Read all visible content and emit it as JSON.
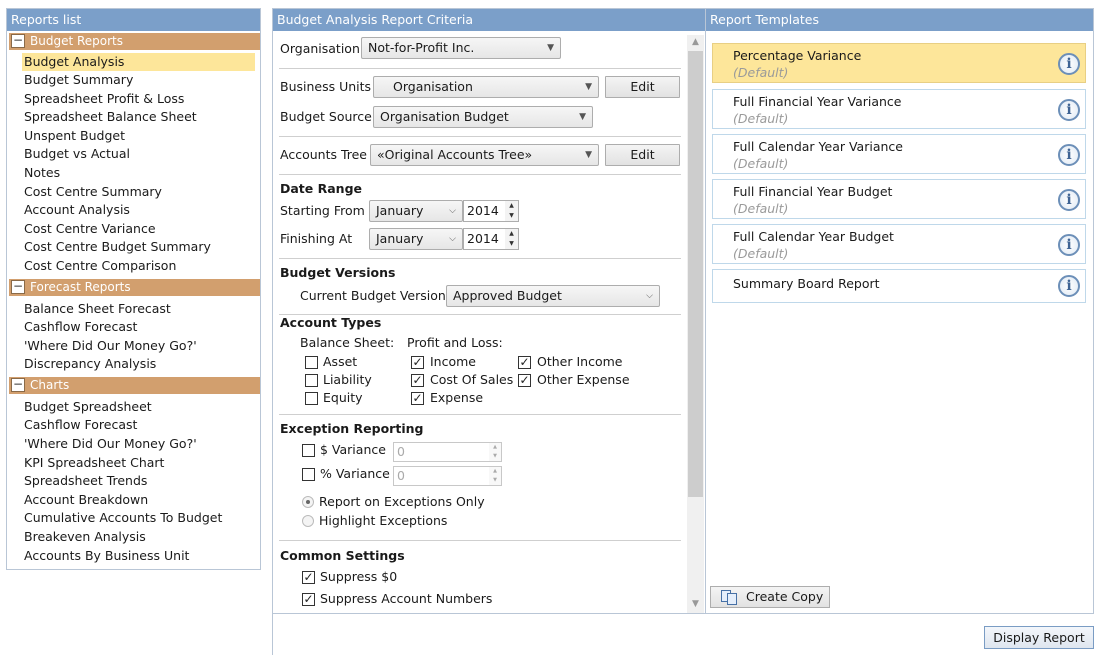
{
  "reports_list": {
    "title": "Reports list",
    "groups": [
      {
        "toggle": "−",
        "title": "Budget Reports",
        "items": [
          "Budget Analysis",
          "Budget Summary",
          "Spreadsheet Profit & Loss",
          "Spreadsheet Balance Sheet",
          "Unspent Budget",
          "Budget vs Actual",
          "Notes",
          "Cost Centre Summary",
          "Account Analysis",
          "Cost Centre Variance",
          "Cost Centre Budget Summary",
          "Cost Centre Comparison"
        ]
      },
      {
        "toggle": "−",
        "title": "Forecast Reports",
        "items": [
          "Balance Sheet Forecast",
          "Cashflow Forecast",
          "'Where Did Our Money Go?'",
          "Discrepancy Analysis"
        ]
      },
      {
        "toggle": "−",
        "title": "Charts",
        "items": [
          "Budget Spreadsheet",
          "Cashflow Forecast",
          "'Where Did Our Money Go?'",
          "KPI Spreadsheet Chart",
          "Spreadsheet Trends",
          "Account Breakdown",
          "Cumulative Accounts To Budget",
          "Breakeven Analysis",
          "Accounts By Business Unit"
        ]
      }
    ],
    "selected": "Budget Analysis"
  },
  "criteria": {
    "title": "Budget Analysis  Report Criteria",
    "organisation_label": "Organisation",
    "organisation_value": "Not-for-Profit Inc.",
    "business_units_label": "Business Units",
    "business_units_value": "Organisation",
    "edit_label": "Edit",
    "budget_source_label": "Budget Source",
    "budget_source_value": "Organisation Budget",
    "accounts_tree_label": "Accounts Tree",
    "accounts_tree_value": "«Original Accounts Tree»",
    "date_range_heading": "Date Range",
    "starting_from_label": "Starting From",
    "starting_month": "January",
    "starting_year": "2014",
    "finishing_at_label": "Finishing At",
    "finishing_month": "January",
    "finishing_year": "2014",
    "budget_versions_heading": "Budget Versions",
    "current_version_label": "Current Budget Version",
    "current_version_value": "Approved Budget",
    "account_types_heading": "Account Types",
    "balance_sheet_label": "Balance Sheet:",
    "profit_loss_label": "Profit and Loss:",
    "balance_sheet_items": [
      {
        "label": "Asset",
        "checked": false
      },
      {
        "label": "Liability",
        "checked": false
      },
      {
        "label": "Equity",
        "checked": false
      }
    ],
    "profit_loss_items": [
      {
        "label": "Income",
        "checked": true
      },
      {
        "label": "Cost Of Sales",
        "checked": true
      },
      {
        "label": "Expense",
        "checked": true
      }
    ],
    "other_items": [
      {
        "label": "Other Income",
        "checked": true
      },
      {
        "label": "Other Expense",
        "checked": true
      }
    ],
    "exception_heading": "Exception Reporting",
    "dollar_variance_label": "$ Variance",
    "dollar_variance_value": "0",
    "percent_variance_label": "% Variance",
    "percent_variance_value": "0",
    "report_exceptions_label": "Report on Exceptions Only",
    "highlight_exceptions_label": "Highlight Exceptions",
    "common_heading": "Common Settings",
    "suppress_zero_label": "Suppress $0",
    "suppress_account_numbers_label": "Suppress Account Numbers",
    "check_mark": "✓"
  },
  "templates": {
    "title": "Report Templates",
    "items": [
      {
        "name": "Percentage Variance",
        "sub": "(Default)"
      },
      {
        "name": "Full Financial Year Variance",
        "sub": "(Default)"
      },
      {
        "name": "Full Calendar Year Variance",
        "sub": "(Default)"
      },
      {
        "name": "Full Financial Year Budget",
        "sub": "(Default)"
      },
      {
        "name": "Full Calendar Year Budget",
        "sub": "(Default)"
      },
      {
        "name": "Summary Board Report",
        "sub": ""
      }
    ],
    "info_glyph": "i",
    "create_copy_label": "Create Copy"
  },
  "display_report_label": "Display Report",
  "icons": {
    "info": "info-icon",
    "copy": "copy-icon",
    "dropdown": "chevron-down-icon"
  },
  "colors": {
    "header": "#7b9fc9",
    "group_header": "#d29f6e",
    "selection": "#fde69a"
  }
}
